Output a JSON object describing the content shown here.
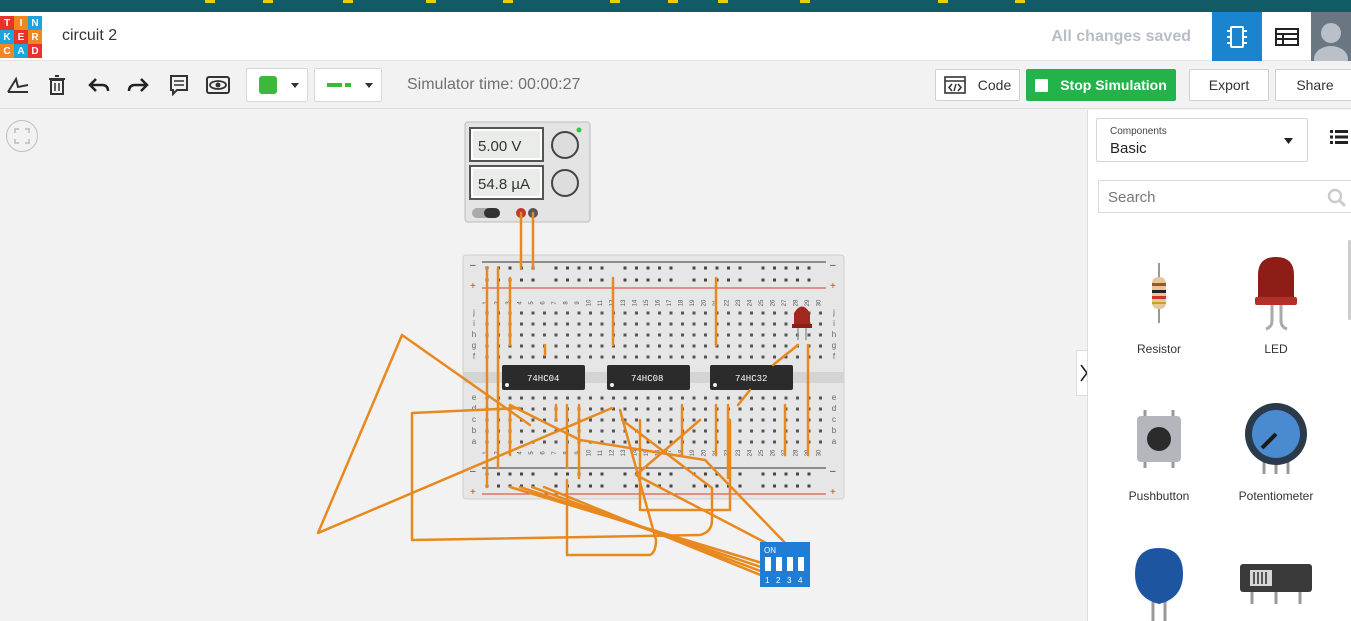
{
  "app": {
    "logo_letters": [
      "T",
      "I",
      "N",
      "K",
      "E",
      "R",
      "C",
      "A",
      "D"
    ],
    "logo_colors": [
      "#e8332b",
      "#f08722",
      "#1aa6dc",
      "#1aa6dc",
      "#e8332b",
      "#f08722",
      "#f08722",
      "#1aa6dc",
      "#e8332b"
    ],
    "document_title": "circuit 2",
    "save_status": "All changes saved",
    "accent": "#1a84ce"
  },
  "toolbar": {
    "simulator_time": "Simulator time: 00:00:27",
    "color_swatch": "#3cb83c",
    "wire_color": "#3cb83c",
    "code_label": "Code",
    "stop_label": "Stop Simulation",
    "export_label": "Export",
    "share_label": "Share"
  },
  "power_supply": {
    "voltage": "5.00 V",
    "current": "54.8 µA"
  },
  "breadboard": {
    "top_row_letters": [
      "j",
      "i",
      "h",
      "g",
      "f"
    ],
    "bottom_row_letters": [
      "e",
      "d",
      "c",
      "b",
      "a"
    ],
    "column_numbers": [
      "1",
      "2",
      "3",
      "4",
      "5",
      "6",
      "7",
      "8",
      "9",
      "10",
      "11",
      "12",
      "13",
      "14",
      "15",
      "16",
      "17",
      "18",
      "19",
      "20",
      "21",
      "22",
      "23",
      "24",
      "25",
      "26",
      "27",
      "28",
      "29",
      "30"
    ],
    "rail_minus": "–",
    "rail_plus": "+"
  },
  "chips": [
    {
      "label": "74HC04"
    },
    {
      "label": "74HC08"
    },
    {
      "label": "74HC32"
    }
  ],
  "dip_switch": {
    "on_label": "ON",
    "numbers": [
      "1",
      "2",
      "3",
      "4"
    ]
  },
  "sidebar": {
    "components_label": "Components",
    "components_value": "Basic",
    "search_placeholder": "Search",
    "items": [
      {
        "label": "Resistor",
        "icon": "resistor-icon"
      },
      {
        "label": "LED",
        "icon": "led-icon"
      },
      {
        "label": "Pushbutton",
        "icon": "pushbutton-icon"
      },
      {
        "label": "Potentiometer",
        "icon": "potentiometer-icon"
      },
      {
        "label": "",
        "icon": "capacitor-icon"
      },
      {
        "label": "",
        "icon": "slide-switch-icon"
      }
    ]
  },
  "colors": {
    "wire": "#e8891f",
    "chip": "#2b2b2b",
    "breadboard": "#e6e6e6",
    "dip_switch": "#1f7dd6",
    "led": "#a3271e"
  }
}
